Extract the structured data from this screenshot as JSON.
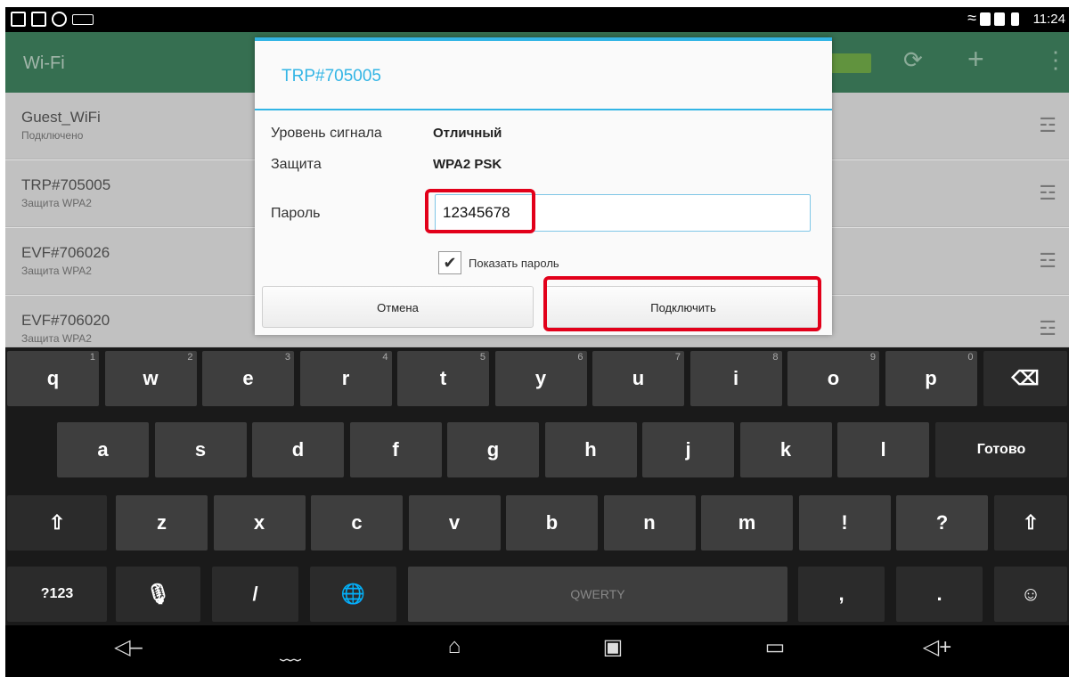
{
  "status": {
    "time": "11:24"
  },
  "actionbar": {
    "title": "Wi-Fi"
  },
  "networks": [
    {
      "name": "Guest_WiFi",
      "status": "Подключено"
    },
    {
      "name": "TRP#705005",
      "status": "Защита WPA2"
    },
    {
      "name": "EVF#706026",
      "status": "Защита WPA2"
    },
    {
      "name": "EVF#706020",
      "status": "Защита WPA2"
    }
  ],
  "dialog": {
    "title": "TRP#705005",
    "signal_label": "Уровень сигнала",
    "signal_value": "Отличный",
    "security_label": "Защита",
    "security_value": "WPA2 PSK",
    "password_label": "Пароль",
    "password_value": "12345678",
    "show_password": "Показать пароль",
    "show_password_checked": true,
    "cancel": "Отмена",
    "connect": "Подключить"
  },
  "keyboard": {
    "row1": [
      {
        "k": "q",
        "h": "1"
      },
      {
        "k": "w",
        "h": "2"
      },
      {
        "k": "e",
        "h": "3"
      },
      {
        "k": "r",
        "h": "4"
      },
      {
        "k": "t",
        "h": "5"
      },
      {
        "k": "y",
        "h": "6"
      },
      {
        "k": "u",
        "h": "7"
      },
      {
        "k": "i",
        "h": "8"
      },
      {
        "k": "o",
        "h": "9"
      },
      {
        "k": "p",
        "h": "0"
      }
    ],
    "row2": [
      "a",
      "s",
      "d",
      "f",
      "g",
      "h",
      "j",
      "k",
      "l"
    ],
    "done": "Готово",
    "row3": [
      "z",
      "x",
      "c",
      "v",
      "b",
      "n",
      "m",
      "!",
      "?"
    ],
    "sym": "?123",
    "slash": "/",
    "space": "QWERTY",
    "comma": ",",
    "period": "."
  },
  "icons": {
    "wifi": "wifi-lock-icon",
    "backspace": "backspace-icon",
    "shift": "shift-icon",
    "mic": "mic-icon",
    "globe": "globe-icon",
    "smiley": "smiley-icon"
  },
  "colors": {
    "accent": "#33b5e5",
    "actionbar": "#3e7f5d",
    "highlight": "#e2001a"
  }
}
